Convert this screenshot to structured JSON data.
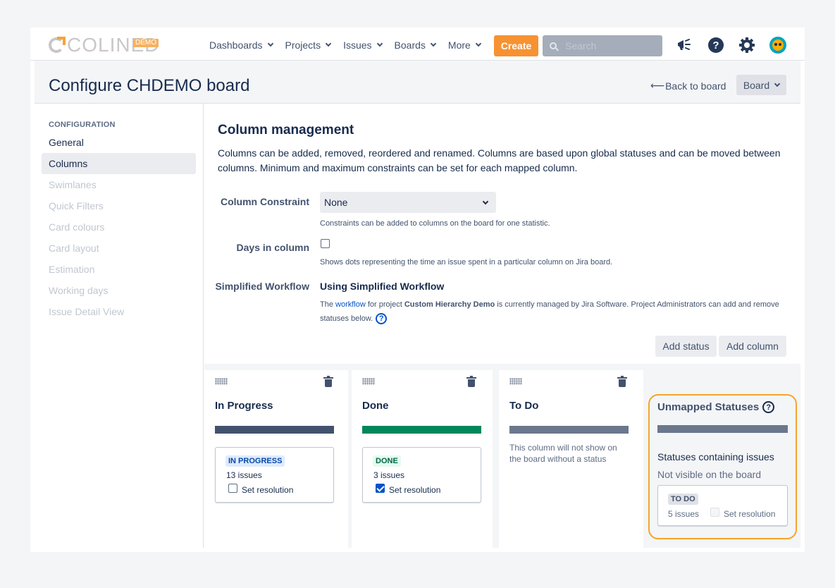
{
  "brand": {
    "logo_text": "COLINED",
    "logo_badge": "DEMO"
  },
  "nav": {
    "items": [
      {
        "label": "Dashboards"
      },
      {
        "label": "Projects"
      },
      {
        "label": "Issues"
      },
      {
        "label": "Boards"
      },
      {
        "label": "More"
      }
    ],
    "create_label": "Create",
    "search_placeholder": "Search"
  },
  "header": {
    "title": "Configure CHDEMO board",
    "back_label": "Back to board",
    "board_button": "Board"
  },
  "sidebar": {
    "heading": "CONFIGURATION",
    "items": [
      {
        "label": "General",
        "state": "normal"
      },
      {
        "label": "Columns",
        "state": "active"
      },
      {
        "label": "Swimlanes",
        "state": "disabled"
      },
      {
        "label": "Quick Filters",
        "state": "disabled"
      },
      {
        "label": "Card colours",
        "state": "disabled"
      },
      {
        "label": "Card layout",
        "state": "disabled"
      },
      {
        "label": "Estimation",
        "state": "disabled"
      },
      {
        "label": "Working days",
        "state": "disabled"
      },
      {
        "label": "Issue Detail View",
        "state": "disabled"
      }
    ]
  },
  "main": {
    "title": "Column management",
    "intro": "Columns can be added, removed, reordered and renamed. Columns are based upon global statuses and can be moved between columns. Minimum and maximum constraints can be set for each mapped column.",
    "constraint": {
      "label": "Column Constraint",
      "value": "None",
      "hint": "Constraints can be added to columns on the board for one statistic."
    },
    "days_in_column": {
      "label": "Days in column",
      "checked": false,
      "hint": "Shows dots representing the time an issue spent in a particular column on Jira board."
    },
    "simplified_workflow": {
      "label": "Simplified Workflow",
      "value": "Using Simplified Workflow",
      "desc_prefix": "The ",
      "desc_link": "workflow",
      "desc_middle": " for project ",
      "desc_project": "Custom Hierarchy Demo",
      "desc_suffix": " is currently managed by Jira Software. Project Administrators can add and remove statuses below."
    },
    "add_status_label": "Add status",
    "add_column_label": "Add column"
  },
  "columns": [
    {
      "name": "In Progress",
      "bar_color": "#42526e",
      "status": {
        "label": "IN PROGRESS",
        "bg": "#deebff",
        "fg": "#0747a6",
        "issues": "13 issues",
        "set_resolution": "Set resolution",
        "checked": false
      }
    },
    {
      "name": "Done",
      "bar_color": "#00875a",
      "status": {
        "label": "DONE",
        "bg": "#e3fcef",
        "fg": "#006644",
        "issues": "3 issues",
        "set_resolution": "Set resolution",
        "checked": true
      }
    },
    {
      "name": "To Do",
      "bar_color": "#6b778c",
      "note": "This column will not show on the board without a status"
    }
  ],
  "unmapped": {
    "title": "Unmapped Statuses",
    "line1": "Statuses containing issues",
    "line2": "Not visible on the board",
    "status": {
      "label": "TO DO",
      "issues": "5 issues",
      "set_resolution": "Set resolution"
    },
    "highlight_color": "#f5a52c"
  }
}
